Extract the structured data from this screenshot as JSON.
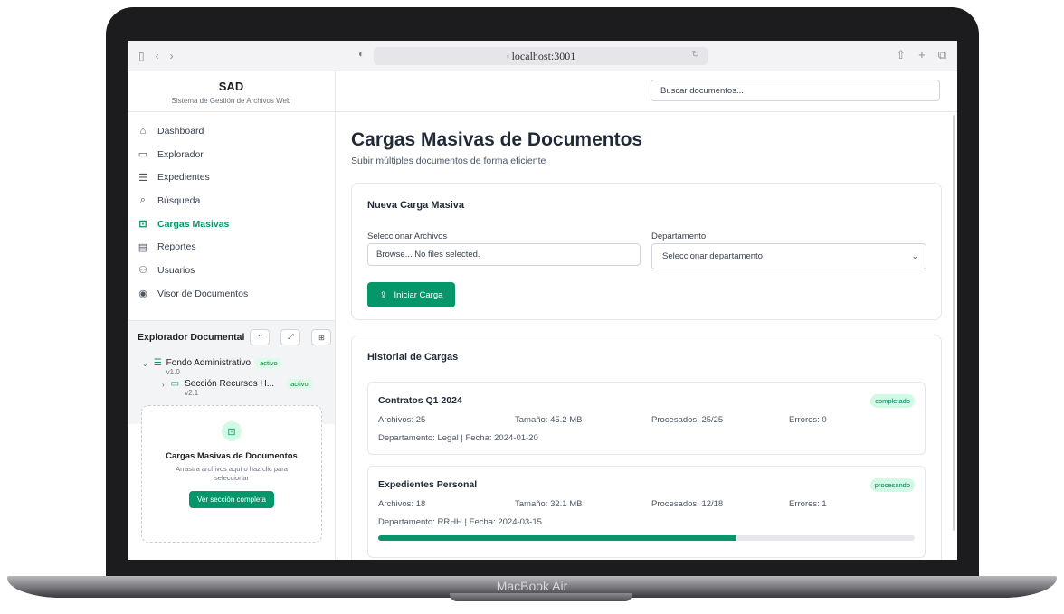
{
  "device": {
    "label": "MacBook Air"
  },
  "browser": {
    "url": "localhost:3001"
  },
  "app": {
    "title": "SAD",
    "subtitle": "Sistema de Gestión de Archivos Web"
  },
  "sidebar": {
    "items": [
      {
        "label": "Dashboard",
        "icon": "home-icon"
      },
      {
        "label": "Explorador",
        "icon": "folder-icon"
      },
      {
        "label": "Expedientes",
        "icon": "database-icon"
      },
      {
        "label": "Búsqueda",
        "icon": "search-icon"
      },
      {
        "label": "Cargas Masivas",
        "icon": "file-upload-icon",
        "active": true
      },
      {
        "label": "Reportes",
        "icon": "report-icon"
      },
      {
        "label": "Usuarios",
        "icon": "users-icon"
      },
      {
        "label": "Visor de Documentos",
        "icon": "eye-icon"
      }
    ]
  },
  "explorer": {
    "title": "Explorador Documental",
    "tree": [
      {
        "name": "Fondo Administrativo",
        "status": "activo",
        "version": "v1.0"
      },
      {
        "name": "Sección Recursos H...",
        "status": "activo",
        "version": "v2.1"
      }
    ]
  },
  "upload_widget": {
    "title": "Cargas Masivas de Documentos",
    "description": "Arrastra archivos aquí o haz clic para seleccionar",
    "button": "Ver sección completa"
  },
  "search": {
    "placeholder": "Buscar documentos..."
  },
  "page": {
    "title": "Cargas Masivas de Documentos",
    "subtitle": "Subir múltiples documentos de forma eficiente"
  },
  "new_upload": {
    "title": "Nueva Carga Masiva",
    "files_label": "Seleccionar Archivos",
    "file_input_value": "Browse... No files selected.",
    "department_label": "Departamento",
    "department_value": "Seleccionar departamento",
    "start_button": "Iniciar Carga"
  },
  "history": {
    "title": "Historial de Cargas",
    "uploads": [
      {
        "name": "Contratos Q1 2024",
        "status": "completado",
        "archivos": "Archivos: 25",
        "tamano": "Tamaño: 45.2 MB",
        "procesados": "Procesados: 25/25",
        "errores": "Errores: 0",
        "meta": "Departamento: Legal | Fecha: 2024-01-20"
      },
      {
        "name": "Expedientes Personal",
        "status": "procesando",
        "archivos": "Archivos: 18",
        "tamano": "Tamaño: 32.1 MB",
        "procesados": "Procesados: 12/18",
        "errores": "Errores: 1",
        "meta": "Departamento: RRHH | Fecha: 2024-03-15",
        "progress": 0.667
      }
    ]
  }
}
